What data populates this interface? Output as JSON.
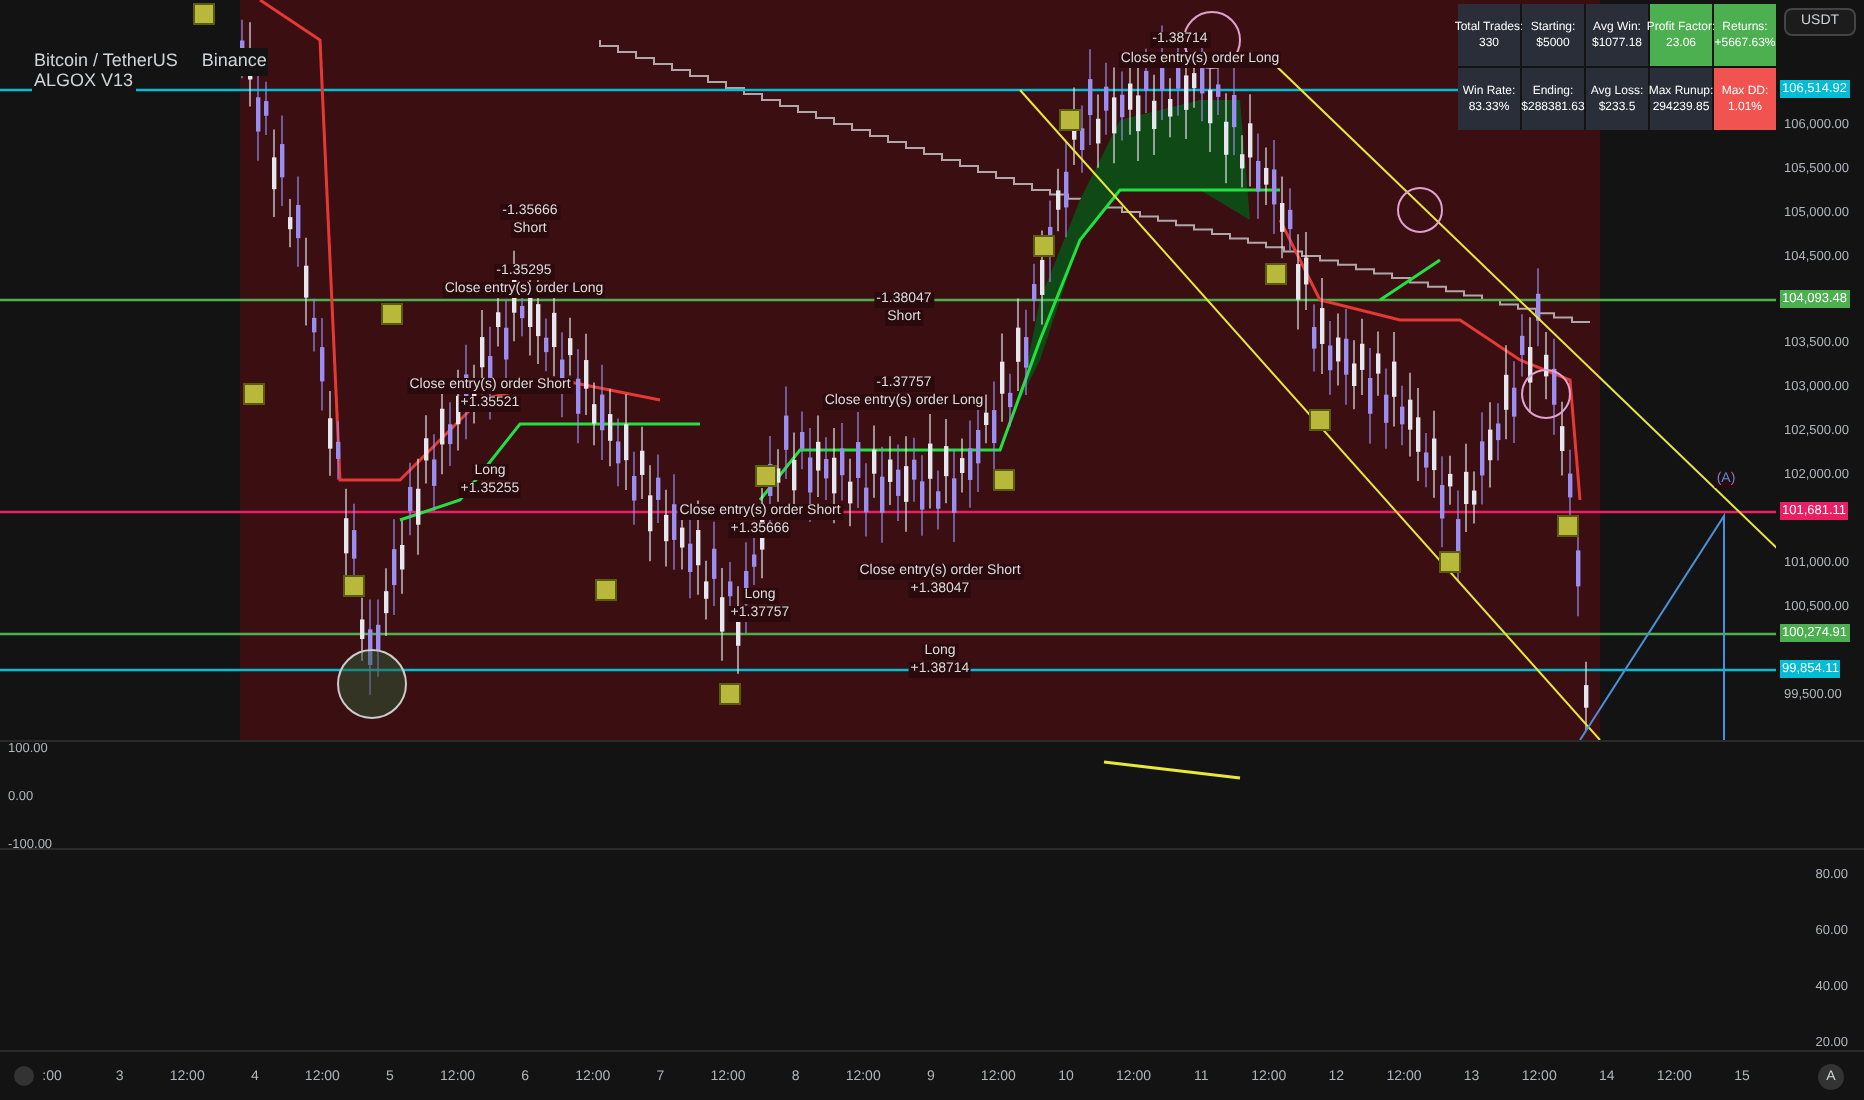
{
  "header": {
    "symbol": "Bitcoin / TetherUS",
    "exchange": "Binance",
    "indicator": "ALGOX V13"
  },
  "stats": [
    {
      "label": "Total Trades:",
      "value": "330",
      "color": "#2a2e39"
    },
    {
      "label": "Starting:",
      "value": "$5000",
      "color": "#2a2e39"
    },
    {
      "label": "Avg Win:",
      "value": "$1077.18",
      "color": "#2a2e39"
    },
    {
      "label": "Profit Factor:",
      "value": "23.06",
      "color": "#4caf50"
    },
    {
      "label": "Returns:",
      "value": "+5667.63%",
      "color": "#4caf50"
    },
    {
      "label": "Win Rate:",
      "value": "83.33%",
      "color": "#2a2e39"
    },
    {
      "label": "Ending:",
      "value": "$288381.63",
      "color": "#2a2e39"
    },
    {
      "label": "Avg Loss:",
      "value": "$233.5",
      "color": "#2a2e39"
    },
    {
      "label": "Max Runup:",
      "value": "294239.85",
      "color": "#2a2e39"
    },
    {
      "label": "Max DD:",
      "value": "1.01%",
      "color": "#f05350"
    }
  ],
  "currency_button": "USDT",
  "price_axis": {
    "ticks": [
      "106,000.00",
      "105,500.00",
      "105,000.00",
      "104,500.00",
      "103,500.00",
      "103,000.00",
      "102,500.00",
      "102,000.00",
      "101,000.00",
      "100,500.00",
      "99,500.00"
    ],
    "levels": [
      {
        "label": "106,514.92",
        "color": "#00bcd4"
      },
      {
        "label": "104,093.48",
        "color": "#4caf50"
      },
      {
        "label": "101,681.11",
        "color": "#e91e63"
      },
      {
        "label": "100,274.91",
        "color": "#4caf50"
      },
      {
        "label": "99,854.11",
        "color": "#00bcd4"
      }
    ]
  },
  "annotations": [
    {
      "text": "-1.38714"
    },
    {
      "text": "Close entry(s) order Long"
    },
    {
      "text": "-1.35666"
    },
    {
      "text": "Short"
    },
    {
      "text": "-1.35295"
    },
    {
      "text": "Close entry(s) order Long"
    },
    {
      "text": "Close entry(s) order Short"
    },
    {
      "text": "+1.35521"
    },
    {
      "text": "Long"
    },
    {
      "text": "+1.35255"
    },
    {
      "text": "-1.38047"
    },
    {
      "text": "Short"
    },
    {
      "text": "-1.37757"
    },
    {
      "text": "Close entry(s) order Long"
    },
    {
      "text": "Close entry(s) order Short"
    },
    {
      "text": "+1.35666"
    },
    {
      "text": "Long"
    },
    {
      "text": "+1.37757"
    },
    {
      "text": "Close entry(s) order Short"
    },
    {
      "text": "+1.38047"
    },
    {
      "text": "Long"
    },
    {
      "text": "+1.38714"
    },
    {
      "text": "(A)"
    }
  ],
  "oscillator_axis": {
    "ticks": [
      "100.00",
      "0.00",
      "-100.00"
    ]
  },
  "lower_axis": {
    "ticks": [
      "80.00",
      "60.00",
      "40.00",
      "20.00"
    ]
  },
  "time_axis": {
    "labels": [
      ":00",
      "3",
      "12:00",
      "4",
      "12:00",
      "5",
      "12:00",
      "6",
      "12:00",
      "7",
      "12:00",
      "8",
      "12:00",
      "9",
      "12:00",
      "10",
      "12:00",
      "11",
      "12:00",
      "12",
      "12:00",
      "13",
      "12:00",
      "14",
      "12:00",
      "15"
    ],
    "auto_button": "A"
  }
}
